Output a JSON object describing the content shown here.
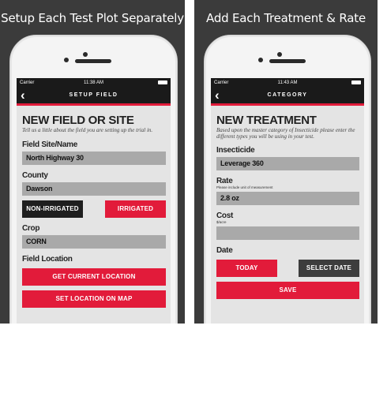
{
  "left": {
    "caption": "Setup Each Test Plot Separately",
    "status": {
      "carrier": "Carrier",
      "time": "11:38 AM"
    },
    "nav_title": "SETUP FIELD",
    "heading": "NEW FIELD OR SITE",
    "subtitle": "Tell us a little about the field you are setting up the trial in.",
    "field_site_label": "Field Site/Name",
    "field_site_value": "North Highway 30",
    "county_label": "County",
    "county_value": "Dawson",
    "non_irrigated_label": "NON-IRRIGATED",
    "irrigated_label": "IRRIGATED",
    "crop_label": "Crop",
    "crop_value": "CORN",
    "location_label": "Field Location",
    "current_location_label": "GET CURRENT LOCATION",
    "map_location_label": "SET LOCATION ON MAP"
  },
  "right": {
    "caption": "Add Each Treatment & Rate",
    "status": {
      "carrier": "Carrier",
      "time": "11:43 AM"
    },
    "nav_title": "CATEGORY",
    "heading": "NEW TREATMENT",
    "subtitle": "Based upon the master category of Insecticide please enter the different types you will be using in your test.",
    "insecticide_label": "Insecticide",
    "insecticide_value": "Leverage 360",
    "rate_label": "Rate",
    "rate_hint": "Please include unit of measurement",
    "rate_value": "2.8 oz",
    "cost_label": "Cost",
    "cost_hint": "$/acre",
    "cost_value": "",
    "date_label": "Date",
    "today_label": "TODAY",
    "select_date_label": "SELECT DATE",
    "save_label": "SAVE"
  },
  "colors": {
    "accent": "#e21b3a",
    "dark": "#1a1a1a",
    "panel_bg": "#3b3b3b",
    "field_bg": "#a9a9a9"
  }
}
